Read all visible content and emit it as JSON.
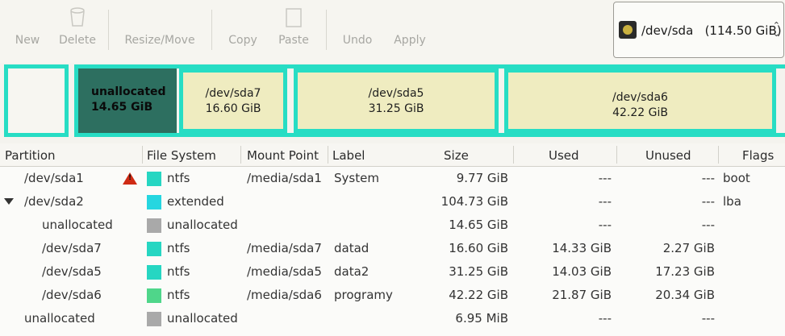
{
  "toolbar": {
    "new_label": "New",
    "delete_label": "Delete",
    "resize_move_label": "Resize/Move",
    "copy_label": "Copy",
    "paste_label": "Paste",
    "undo_label": "Undo",
    "apply_label": "Apply"
  },
  "device": {
    "name": "/dev/sda",
    "size": "(114.50 GiB)"
  },
  "partition_map": {
    "unallocated": {
      "name": "unallocated",
      "size": "14.65 GiB"
    },
    "sda7": {
      "name": "/dev/sda7",
      "size": "16.60 GiB"
    },
    "sda5": {
      "name": "/dev/sda5",
      "size": "31.25 GiB"
    },
    "sda6": {
      "name": "/dev/sda6",
      "size": "42.22 GiB"
    }
  },
  "columns": {
    "partition": "Partition",
    "file_system": "File System",
    "mount_point": "Mount Point",
    "label": "Label",
    "size": "Size",
    "used": "Used",
    "unused": "Unused",
    "flags": "Flags"
  },
  "rows": [
    {
      "partition": "/dev/sda1",
      "fs": "ntfs",
      "fs_color": "#26d6c2",
      "mount": "/media/sda1",
      "label": "System",
      "size": "9.77 GiB",
      "used": "---",
      "unused": "---",
      "flags": "boot"
    },
    {
      "partition": "/dev/sda2",
      "fs": "extended",
      "fs_color": "#26d6e0",
      "mount": "",
      "label": "",
      "size": "104.73 GiB",
      "used": "---",
      "unused": "---",
      "flags": "lba"
    },
    {
      "partition": "unallocated",
      "fs": "unallocated",
      "fs_color": "#a9a9a9",
      "mount": "",
      "label": "",
      "size": "14.65 GiB",
      "used": "---",
      "unused": "---",
      "flags": ""
    },
    {
      "partition": "/dev/sda7",
      "fs": "ntfs",
      "fs_color": "#26d6c2",
      "mount": "/media/sda7",
      "label": "datad",
      "size": "16.60 GiB",
      "used": "14.33 GiB",
      "unused": "2.27 GiB",
      "flags": ""
    },
    {
      "partition": "/dev/sda5",
      "fs": "ntfs",
      "fs_color": "#26d6c2",
      "mount": "/media/sda5",
      "label": "data2",
      "size": "31.25 GiB",
      "used": "14.03 GiB",
      "unused": "17.23 GiB",
      "flags": ""
    },
    {
      "partition": "/dev/sda6",
      "fs": "ntfs",
      "fs_color": "#4fd68a",
      "mount": "/media/sda6",
      "label": "programy",
      "size": "42.22 GiB",
      "used": "21.87 GiB",
      "unused": "20.34 GiB",
      "flags": ""
    },
    {
      "partition": "unallocated",
      "fs": "unallocated",
      "fs_color": "#a9a9a9",
      "mount": "",
      "label": "",
      "size": "6.95 MiB",
      "used": "---",
      "unused": "---",
      "flags": ""
    }
  ]
}
